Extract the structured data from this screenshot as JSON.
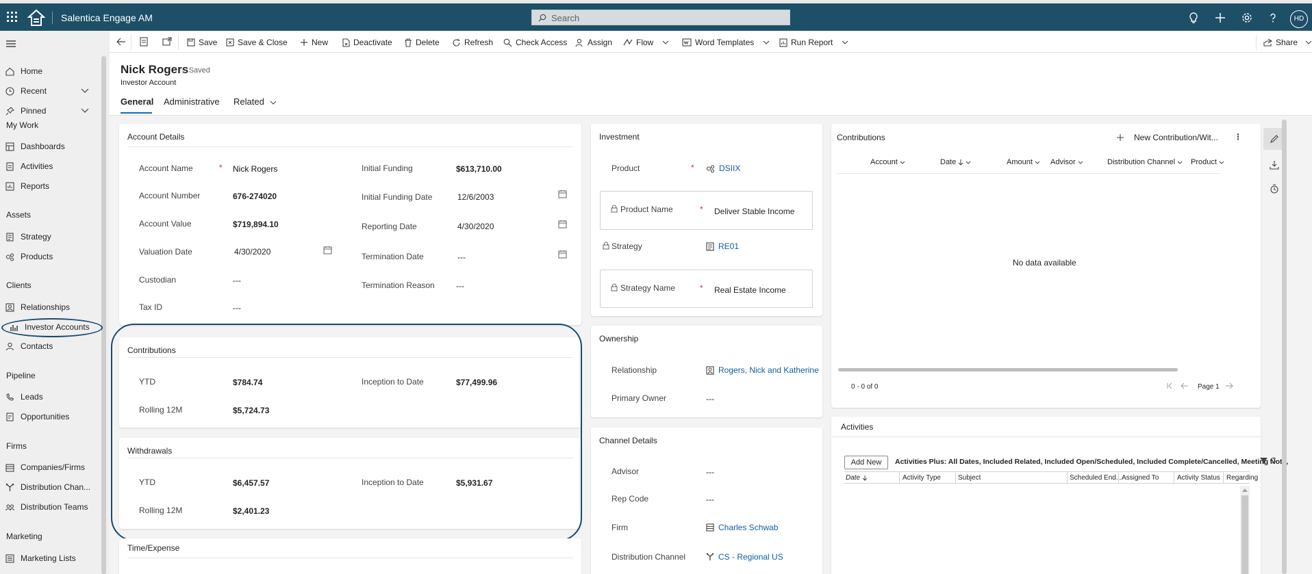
{
  "app": {
    "title": "Salentica Engage AM",
    "search_placeholder": "Search",
    "user_initials": "HD"
  },
  "commands": {
    "save": "Save",
    "save_close": "Save & Close",
    "new": "New",
    "deactivate": "Deactivate",
    "delete": "Delete",
    "refresh": "Refresh",
    "check_access": "Check Access",
    "assign": "Assign",
    "flow": "Flow",
    "word_templates": "Word Templates",
    "run_report": "Run Report",
    "share": "Share"
  },
  "sitemap": {
    "home": "Home",
    "recent": "Recent",
    "pinned": "Pinned",
    "groups": {
      "my_work": "My Work",
      "assets": "Assets",
      "clients": "Clients",
      "pipeline": "Pipeline",
      "firms": "Firms",
      "marketing": "Marketing"
    },
    "items": {
      "dashboards": "Dashboards",
      "activities": "Activities",
      "reports": "Reports",
      "strategy": "Strategy",
      "products": "Products",
      "relationships": "Relationships",
      "investor_accounts": "Investor Accounts",
      "contacts": "Contacts",
      "leads": "Leads",
      "opportunities": "Opportunities",
      "companies": "Companies/Firms",
      "distribution_channels": "Distribution Chan...",
      "distribution_teams": "Distribution Teams",
      "marketing_lists": "Marketing Lists"
    }
  },
  "record": {
    "name": "Nick Rogers",
    "status": "- Saved",
    "entity": "Investor Account",
    "tabs": [
      "General",
      "Administrative",
      "Related"
    ]
  },
  "account_details": {
    "title": "Account Details",
    "account_name_label": "Account Name",
    "account_name": "Nick Rogers",
    "account_number_label": "Account Number",
    "account_number": "676-274020",
    "account_value_label": "Account Value",
    "account_value": "$719,894.10",
    "valuation_date_label": "Valuation Date",
    "valuation_date": "4/30/2020",
    "custodian_label": "Custodian",
    "custodian": "---",
    "tax_id_label": "Tax ID",
    "tax_id": "---",
    "initial_funding_label": "Initial Funding",
    "initial_funding": "$613,710.00",
    "initial_funding_date_label": "Initial Funding Date",
    "initial_funding_date": "12/6/2003",
    "reporting_date_label": "Reporting Date",
    "reporting_date": "4/30/2020",
    "termination_date_label": "Termination Date",
    "termination_date": "---",
    "termination_reason_label": "Termination Reason",
    "termination_reason": "---"
  },
  "contributions_summary": {
    "title": "Contributions",
    "ytd_label": "YTD",
    "ytd": "$784.74",
    "rolling_label": "Rolling 12M",
    "rolling": "$5,724.73",
    "itd_label": "Inception to Date",
    "itd": "$77,499.96"
  },
  "withdrawals_summary": {
    "title": "Withdrawals",
    "ytd_label": "YTD",
    "ytd": "$6,457.57",
    "rolling_label": "Rolling 12M",
    "rolling": "$2,401.23",
    "itd_label": "Inception to Date",
    "itd": "$5,931.67"
  },
  "time_expense": {
    "title": "Time/Expense"
  },
  "investment": {
    "title": "Investment",
    "product_label": "Product",
    "product": "DSIIX",
    "product_name_label": "Product Name",
    "product_name": "Deliver Stable Income",
    "strategy_label": "Strategy",
    "strategy": "RE01",
    "strategy_name_label": "Strategy Name",
    "strategy_name": "Real Estate Income"
  },
  "ownership": {
    "title": "Ownership",
    "relationship_label": "Relationship",
    "relationship": "Rogers, Nick and Katherine",
    "primary_owner_label": "Primary Owner",
    "primary_owner": "---"
  },
  "channel_details": {
    "title": "Channel Details",
    "advisor_label": "Advisor",
    "advisor": "---",
    "rep_code_label": "Rep Code",
    "rep_code": "---",
    "firm_label": "Firm",
    "firm": "Charles Schwab",
    "channel_label": "Distribution Channel",
    "channel": "CS - Regional US"
  },
  "contributions_grid": {
    "title": "Contributions",
    "new_button": "New Contribution/Wit...",
    "columns": [
      "Account",
      "Date",
      "Amount",
      "Advisor",
      "Distribution Channel",
      "Product"
    ],
    "empty_text": "No data available",
    "record_count": "0 - 0 of 0",
    "page": "Page 1"
  },
  "activities": {
    "title": "Activities",
    "add_new": "Add New",
    "view_name": "Activities Plus: All Dates, Included Related, Included Open/Scheduled, Included Complete/Cancelled, Meeting Note,",
    "columns": [
      "Date",
      "Activity Type",
      "Subject",
      "Scheduled End...",
      "Assigned To",
      "Activity Status",
      "Regarding"
    ]
  },
  "colors": {
    "header": "#1d4f67",
    "accent": "#0f6cbd",
    "link": "#115ea3",
    "required": "#c4314b",
    "annotation": "#1a4a6e"
  }
}
